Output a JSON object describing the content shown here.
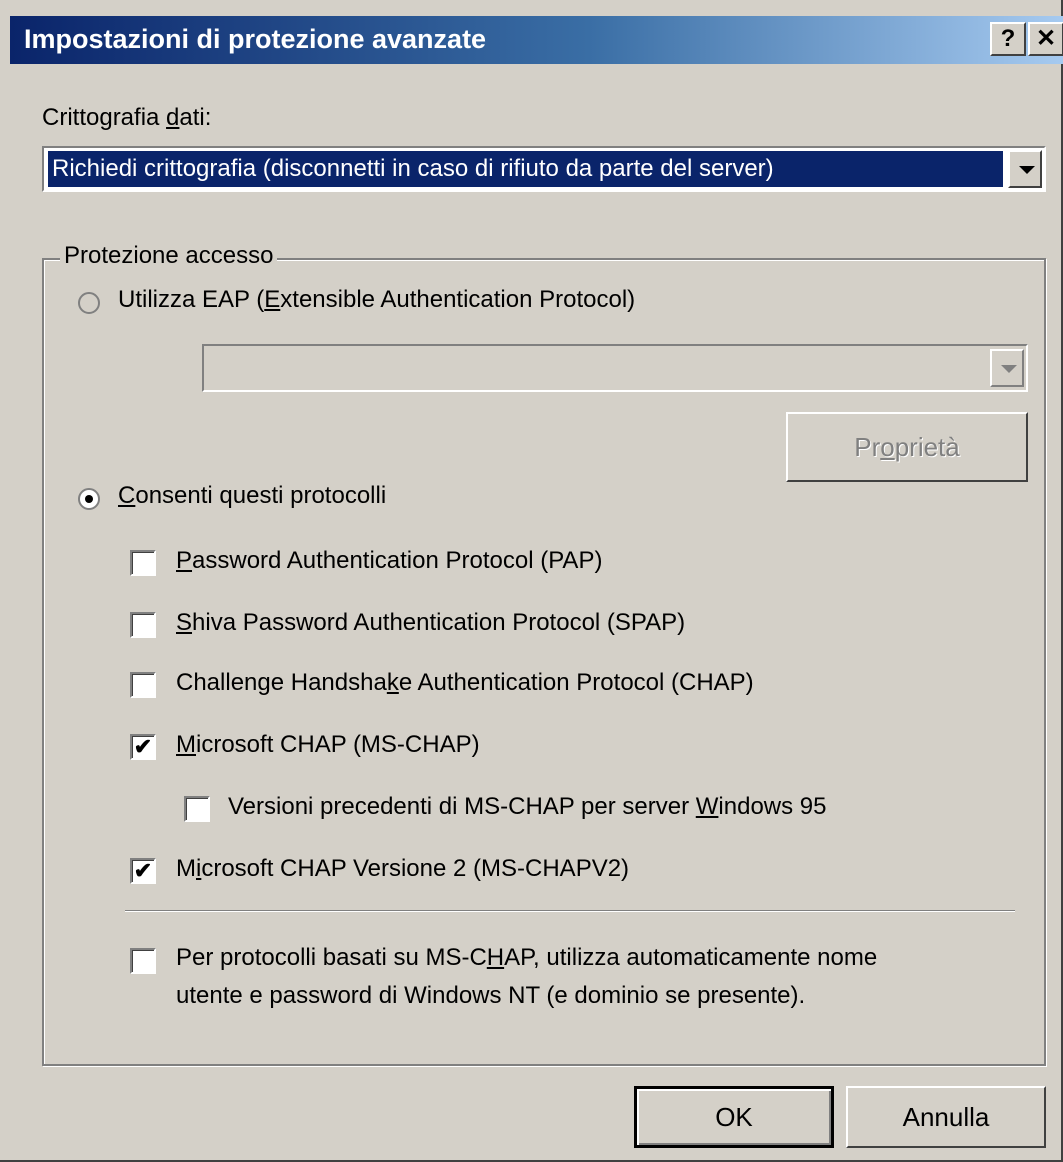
{
  "window": {
    "title": "Impostazioni di protezione avanzate",
    "help_glyph": "?",
    "close_glyph": "✕"
  },
  "encryption": {
    "label_pre": "Crittografia ",
    "label_key": "d",
    "label_post": "ati:",
    "selected": "Richiedi crittografia (disconnetti in caso di rifiuto da parte del server)"
  },
  "logon_security": {
    "group_title": "Protezione accesso",
    "eap": {
      "label_pre": "Utilizza EAP (",
      "label_key": "E",
      "label_post": "xtensible Authentication Protocol)",
      "selected": false,
      "properties_pre": "Pr",
      "properties_key": "o",
      "properties_post": "prietà"
    },
    "allow": {
      "label_key": "C",
      "label_post": "onsenti questi protocolli",
      "selected": true
    },
    "protocols": {
      "pap": {
        "pre": "",
        "key": "P",
        "post": "assword Authentication Protocol (PAP)",
        "checked": false
      },
      "spap": {
        "pre": "",
        "key": "S",
        "post": "hiva Password Authentication Protocol (SPAP)",
        "checked": false
      },
      "chap": {
        "pre": "Challenge Handsha",
        "key": "k",
        "post": "e Authentication Protocol (CHAP)",
        "checked": false
      },
      "mschap": {
        "pre": "",
        "key": "M",
        "post": "icrosoft CHAP (MS-CHAP)",
        "checked": true
      },
      "win95": {
        "pre": "Versioni precedenti di MS-CHAP per server ",
        "key": "W",
        "post": "indows 95",
        "checked": false
      },
      "mschapv2": {
        "pre": "M",
        "key": "i",
        "post": "crosoft CHAP Versione 2 (MS-CHAPV2)",
        "checked": true
      }
    },
    "auto_logon": {
      "line1_pre": "Per protocolli basati su MS-C",
      "line1_key": "H",
      "line1_post": "AP, utilizza automaticamente nome",
      "line2": "utente e password di Windows NT (e dominio se presente).",
      "checked": false
    }
  },
  "buttons": {
    "ok": "OK",
    "cancel": "Annulla"
  },
  "glyphs": {
    "check": "✔"
  }
}
